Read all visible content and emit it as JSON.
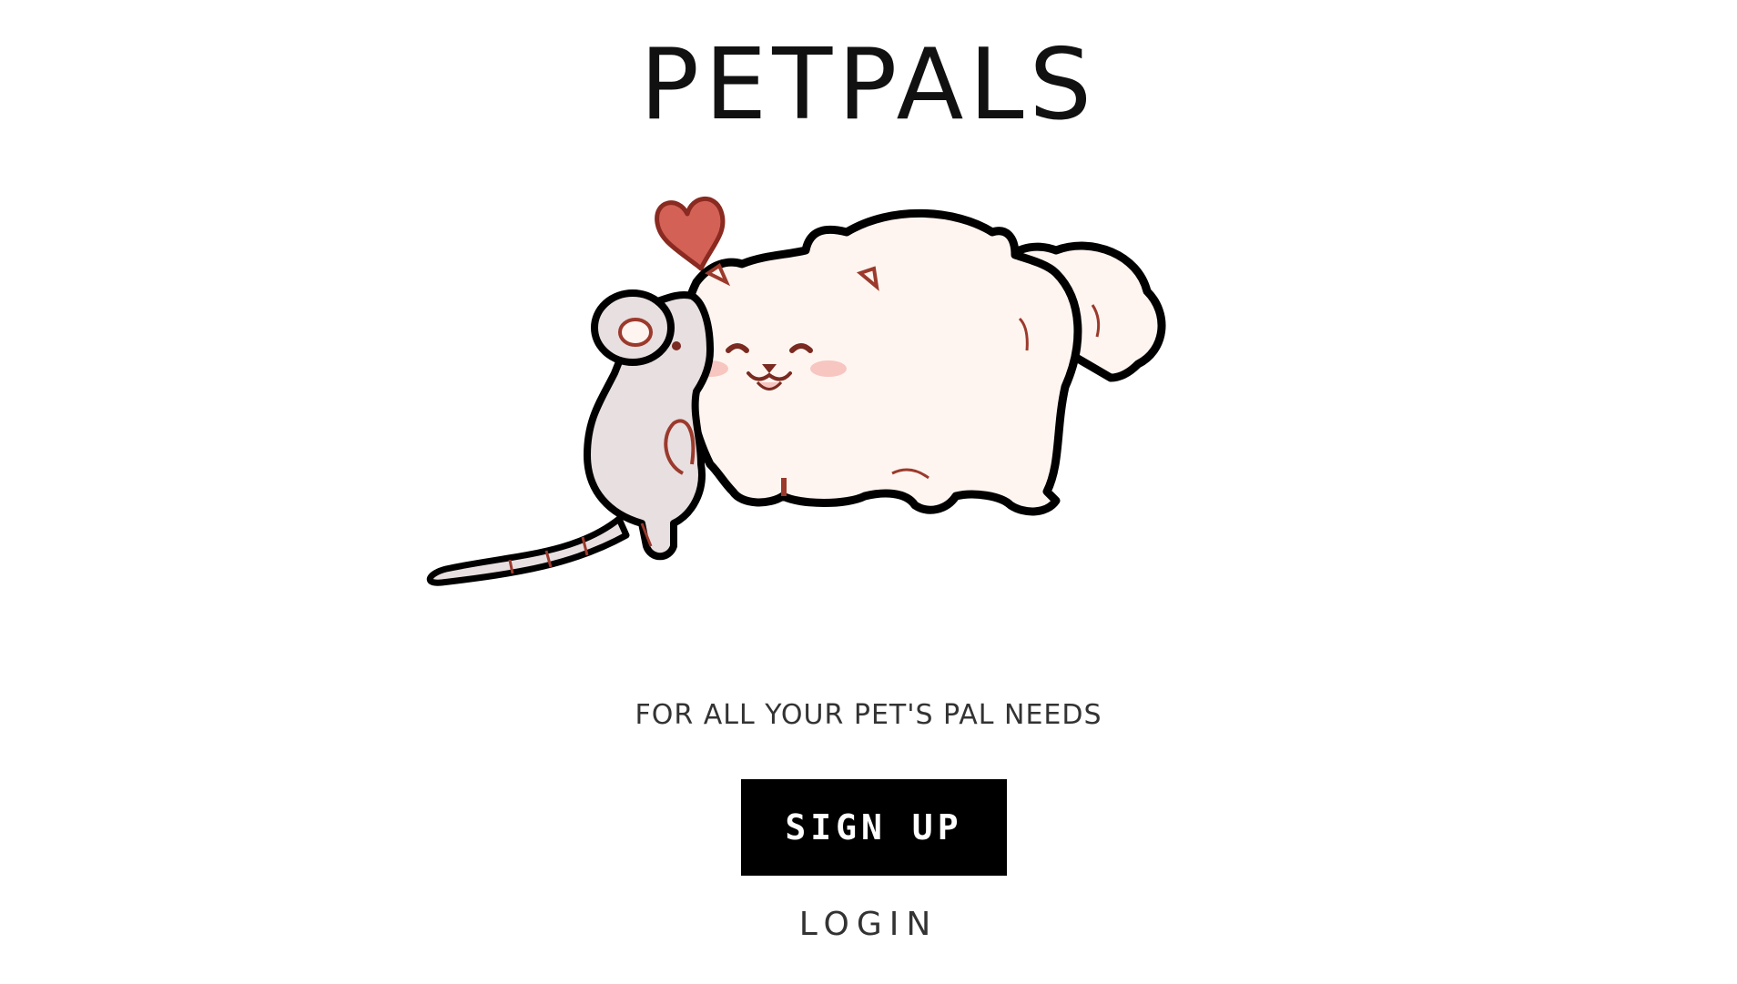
{
  "app": {
    "title": "PETPALS",
    "tagline": "FOR ALL YOUR PET'S PAL NEEDS"
  },
  "actions": {
    "signup_label": "SIGN UP",
    "login_label": "LOGIN"
  },
  "hero": {
    "description_icon": "mouse-and-dog-hero-illustration",
    "heart_color": "#d46156",
    "dog_color": "#fff5f0",
    "mouse_color": "#e8dfe0",
    "accent_color": "#9b3a2c"
  },
  "colors": {
    "button_bg": "#000000",
    "button_text": "#ffffff",
    "text": "#333333"
  }
}
